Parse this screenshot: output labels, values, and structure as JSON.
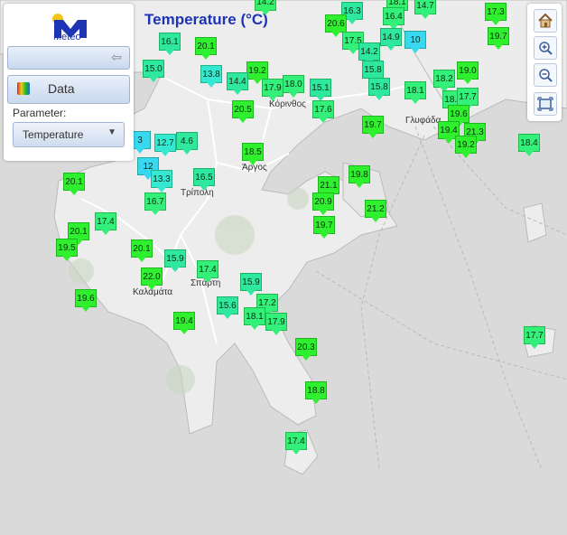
{
  "title": "Temperature (°C)",
  "logo": {
    "text": "Meteo"
  },
  "panel": {
    "data_label": "Data",
    "parameter_label": "Parameter:",
    "parameter_value": "Temperature"
  },
  "toolbar": {
    "home_icon": "home-icon",
    "zoom_in_icon": "zoom-in-icon",
    "zoom_out_icon": "zoom-out-icon",
    "extent_icon": "full-extent-icon"
  },
  "colors": {
    "warm": "#2ff02f",
    "mild": "#33f07a",
    "cool": "#2fe8a0",
    "cold": "#35e8d2",
    "coldest": "#38d8f0",
    "title": "#1d35b4"
  },
  "cities": [
    "Κόρινθος",
    "Γλυφάδα",
    "Άργος",
    "Τρίπολη",
    "Καλαμάτα",
    "Σπάρτη"
  ],
  "stations": [
    "14.2",
    "18.1",
    "14.7",
    "16.3",
    "20.6",
    "16.4",
    "17.3",
    "14.9",
    "10",
    "16.1",
    "20.1",
    "17.5",
    "14.2",
    "19.7",
    "15.0",
    "13.8",
    "19.2",
    "15.8",
    "19.0",
    "14.4",
    "17.9",
    "18.0",
    "15.1",
    "15.8",
    "18.1",
    "18.2",
    "20.5",
    "17.6",
    "18.0",
    "17.7",
    "19.6",
    "19.7",
    "19.4",
    "21.3",
    "19.2",
    "18.4",
    "3",
    "12.7",
    "4.6",
    "18.5",
    "12",
    "13.3",
    "16.5",
    "20.1",
    "16.7",
    "21.1",
    "19.8",
    "20.9",
    "21.2",
    "17.4",
    "20.1",
    "19.7",
    "19.5",
    "20.1",
    "15.9",
    "17.4",
    "22.0",
    "15.9",
    "19.6",
    "17.2",
    "15.6",
    "18.1",
    "17.9",
    "19.4",
    "17.7",
    "20.3",
    "18.8",
    "17.4"
  ]
}
